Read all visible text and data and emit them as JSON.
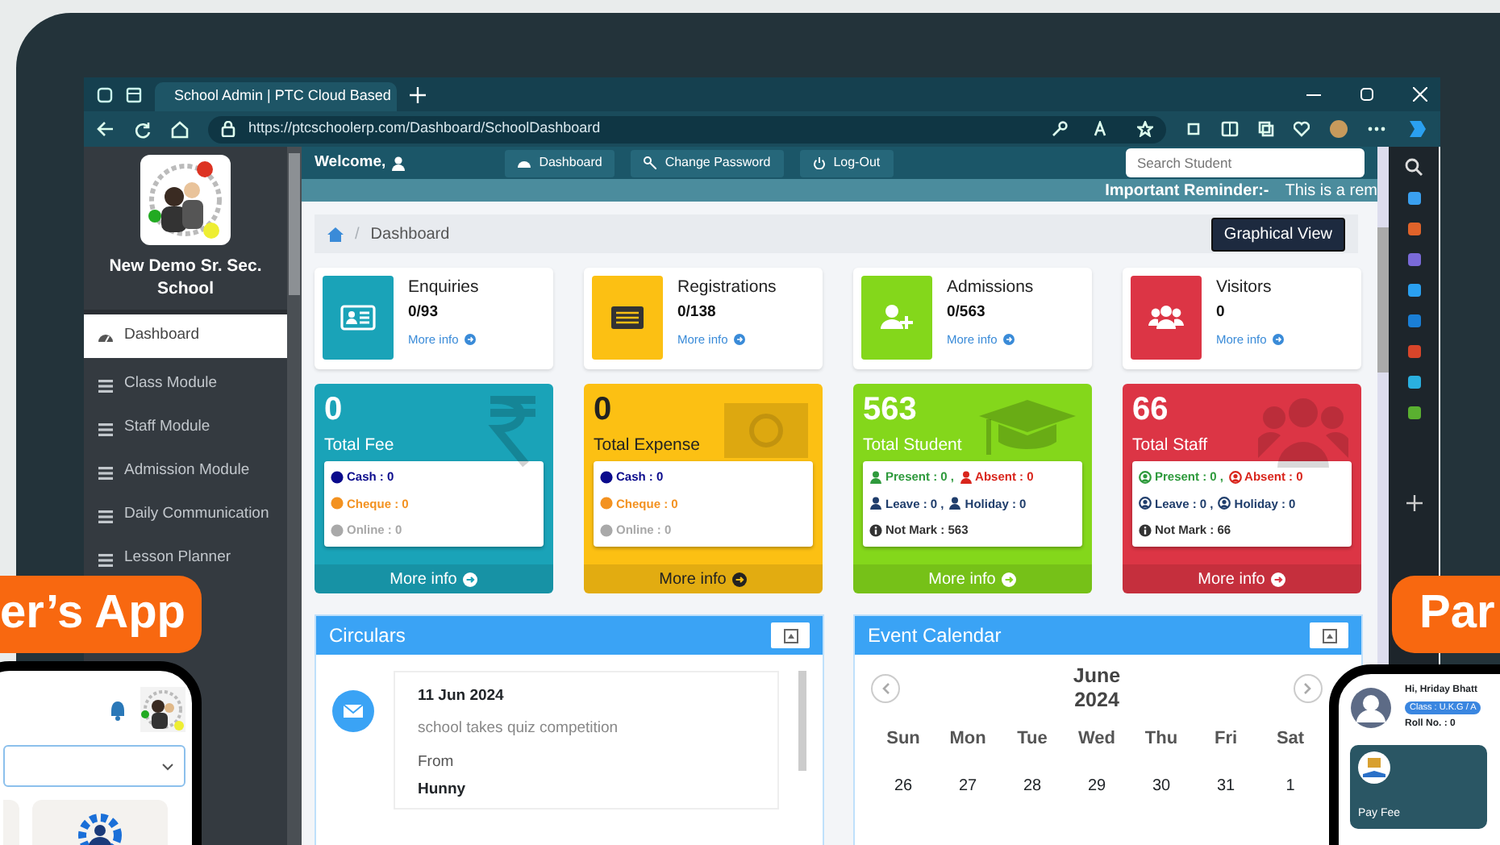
{
  "browser": {
    "tab_title": "School Admin | PTC Cloud Based",
    "url": "https://ptcschoolerp.com/Dashboard/SchoolDashboard"
  },
  "sidebar": {
    "school_name": "New Demo Sr. Sec. School",
    "items": [
      {
        "label": "Dashboard",
        "selected": true
      },
      {
        "label": "Class Module",
        "selected": false
      },
      {
        "label": "Staff Module",
        "selected": false
      },
      {
        "label": "Admission Module",
        "selected": false
      },
      {
        "label": "Daily Communication",
        "selected": false
      },
      {
        "label": "Lesson Planner",
        "selected": false
      }
    ]
  },
  "header": {
    "welcome": "Welcome,",
    "nav": [
      "Dashboard",
      "Change Password",
      "Log-Out"
    ],
    "search_placeholder": "Search Student",
    "reminder_label": "Important Reminder:-",
    "reminder_text": "This is a rem"
  },
  "breadcrumb": {
    "separator": "/",
    "current": "Dashboard",
    "button": "Graphical View"
  },
  "info_cards": [
    {
      "kind": "id-card",
      "title": "Enquiries",
      "value": "0/93",
      "link": "More info",
      "color": "#1aa3b8"
    },
    {
      "kind": "list",
      "title": "Registrations",
      "value": "0/138",
      "link": "More info",
      "color": "#fcc013"
    },
    {
      "kind": "user-plus",
      "title": "Admissions",
      "value": "0/563",
      "link": "More info",
      "color": "#84d71b"
    },
    {
      "kind": "users",
      "title": "Visitors",
      "value": "0",
      "link": "More info",
      "color": "#dc3545"
    }
  ],
  "stat_cards": [
    {
      "kind": "rupee",
      "value": "0",
      "label": "Total Fee",
      "color": "#1aa3b8",
      "dark_text": false,
      "footer": "More info",
      "lines": [
        {
          "parts": [
            {
              "kind": "dot",
              "text": "Cash : 0",
              "color": "#0a0a8c"
            }
          ]
        },
        {
          "parts": [
            {
              "kind": "dot",
              "text": "Cheque : 0",
              "color": "#f39221"
            }
          ]
        },
        {
          "parts": [
            {
              "kind": "dot",
              "text": "Online : 0",
              "color": "#a9a9a9"
            }
          ]
        }
      ]
    },
    {
      "kind": "banknote",
      "value": "0",
      "label": "Total Expense",
      "color": "#fcc013",
      "dark_text": true,
      "footer": "More info",
      "lines": [
        {
          "parts": [
            {
              "kind": "dot",
              "text": "Cash : 0",
              "color": "#0a0a8c"
            }
          ]
        },
        {
          "parts": [
            {
              "kind": "dot",
              "text": "Cheque : 0",
              "color": "#f39221"
            }
          ]
        },
        {
          "parts": [
            {
              "kind": "dot",
              "text": "Online : 0",
              "color": "#a9a9a9"
            }
          ]
        }
      ]
    },
    {
      "kind": "grad-cap",
      "value": "563",
      "label": "Total Student",
      "color": "#84d71b",
      "dark_text": false,
      "footer": "More info",
      "lines": [
        {
          "parts": [
            {
              "kind": "person",
              "text": "Present : 0 ,",
              "color": "#2e9a3c"
            },
            {
              "kind": "person",
              "text": "Absent : 0",
              "color": "#d9251c"
            }
          ]
        },
        {
          "parts": [
            {
              "kind": "person",
              "text": "Leave : 0 ,",
              "color": "#1f3d6b"
            },
            {
              "kind": "person",
              "text": "Holiday : 0",
              "color": "#1f3d6b"
            }
          ]
        },
        {
          "parts": [
            {
              "kind": "info",
              "text": "Not Mark : 563",
              "color": "#333333"
            }
          ]
        }
      ]
    },
    {
      "kind": "users",
      "value": "66",
      "label": "Total Staff",
      "color": "#dc3545",
      "dark_text": false,
      "footer": "More info",
      "lines": [
        {
          "parts": [
            {
              "kind": "person-circle",
              "text": "Present : 0 ,",
              "color": "#2e9a3c"
            },
            {
              "kind": "person-circle",
              "text": "Absent : 0",
              "color": "#d9251c"
            }
          ]
        },
        {
          "parts": [
            {
              "kind": "person-circle",
              "text": "Leave : 0 ,",
              "color": "#1f3d6b"
            },
            {
              "kind": "person-circle",
              "text": "Holiday : 0",
              "color": "#1f3d6b"
            }
          ]
        },
        {
          "parts": [
            {
              "kind": "info",
              "text": "Not Mark : 66",
              "color": "#333333"
            }
          ]
        }
      ]
    }
  ],
  "circulars": {
    "title": "Circulars",
    "items": [
      {
        "date": "11 Jun 2024",
        "text": "school takes quiz competition",
        "from_label": "From",
        "from": "Hunny"
      }
    ]
  },
  "calendar": {
    "title": "Event Calendar",
    "month": "June",
    "year": "2024",
    "weekdays": [
      "Sun",
      "Mon",
      "Tue",
      "Wed",
      "Thu",
      "Fri",
      "Sat"
    ],
    "days": [
      "26",
      "27",
      "28",
      "29",
      "30",
      "31",
      "1"
    ]
  },
  "promo": {
    "left_badge": "er’s App",
    "right_badge": "Par"
  },
  "parent_phone": {
    "greeting": "Hi, Hriday Bhatt",
    "class": "Class : U.K.G / A",
    "roll": "Roll No. : 0",
    "tile": "Pay Fee"
  }
}
